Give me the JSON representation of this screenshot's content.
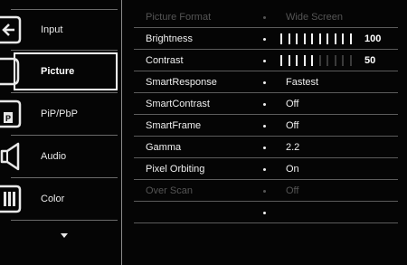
{
  "sidebar": {
    "items": [
      {
        "label": "Input",
        "icon": "input-icon"
      },
      {
        "label": "Picture",
        "icon": "picture-icon",
        "selected": true
      },
      {
        "label": "PiP/PbP",
        "icon": "pip-icon"
      },
      {
        "label": "Audio",
        "icon": "speaker-icon"
      },
      {
        "label": "Color",
        "icon": "color-icon"
      }
    ],
    "more_indicator": "chevron-down-icon"
  },
  "menu": {
    "rows": [
      {
        "name": "Picture Format",
        "value": "Wide Screen",
        "enabled": false
      },
      {
        "name": "Brightness",
        "value": "100",
        "level": 1.0,
        "enabled": true
      },
      {
        "name": "Contrast",
        "value": "50",
        "level": 0.5,
        "enabled": true
      },
      {
        "name": "SmartResponse",
        "value": "Fastest",
        "enabled": true
      },
      {
        "name": "SmartContrast",
        "value": "Off",
        "enabled": true
      },
      {
        "name": "SmartFrame",
        "value": "Off",
        "enabled": true
      },
      {
        "name": "Gamma",
        "value": "2.2",
        "enabled": true
      },
      {
        "name": "Pixel Orbiting",
        "value": "On",
        "enabled": true
      },
      {
        "name": "Over Scan",
        "value": "Off",
        "enabled": false
      },
      {
        "name": "",
        "value": "",
        "enabled": true
      }
    ]
  },
  "colors": {
    "background": "#050505",
    "text": "#f0f0f0",
    "disabled_text": "#555555",
    "selection_border": "#ffffff"
  }
}
